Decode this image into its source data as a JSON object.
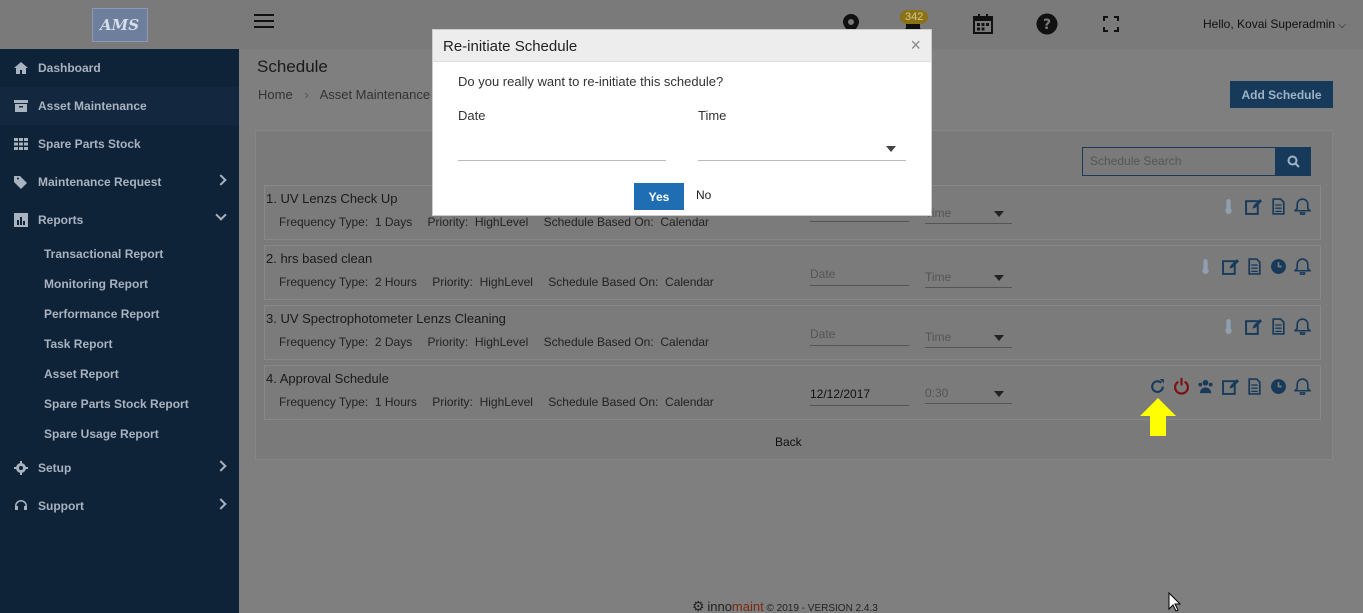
{
  "header": {
    "logo_text": "AMS",
    "notification_count": "342",
    "greeting": "Hello, Kovai Superadmin"
  },
  "sidebar": {
    "items": [
      {
        "label": "Dashboard",
        "icon": "home-icon"
      },
      {
        "label": "Asset Maintenance",
        "icon": "archive-icon"
      },
      {
        "label": "Spare Parts Stock",
        "icon": "grid-icon"
      },
      {
        "label": "Maintenance Request",
        "icon": "tag-icon"
      },
      {
        "label": "Reports",
        "icon": "bar-chart-icon"
      },
      {
        "label": "Setup",
        "icon": "gear-icon"
      },
      {
        "label": "Support",
        "icon": "headset-icon"
      }
    ],
    "report_subitems": [
      "Transactional Report",
      "Monitoring Report",
      "Performance Report",
      "Task Report",
      "Asset Report",
      "Spare Parts Stock Report",
      "Spare Usage Report"
    ]
  },
  "page": {
    "title": "Schedule",
    "breadcrumb": [
      "Home",
      "Asset Maintenance"
    ],
    "add_button": "Add Schedule",
    "search_placeholder": "Schedule Search",
    "back": "Back"
  },
  "schedules": [
    {
      "title": "1. UV Lenzs Check Up",
      "frequency_label": "Frequency Type:",
      "frequency": "1 Days",
      "priority_label": "Priority:",
      "priority": "HighLevel",
      "based_label": "Schedule Based On:",
      "based": "Calendar",
      "date": "",
      "time": "Time"
    },
    {
      "title": "2. hrs based clean",
      "frequency_label": "Frequency Type:",
      "frequency": "2 Hours",
      "priority_label": "Priority:",
      "priority": "HighLevel",
      "based_label": "Schedule Based On:",
      "based": "Calendar",
      "date": "Date",
      "time": "Time"
    },
    {
      "title": "3. UV Spectrophotometer Lenzs Cleaning",
      "frequency_label": "Frequency Type:",
      "frequency": "2 Days",
      "priority_label": "Priority:",
      "priority": "HighLevel",
      "based_label": "Schedule Based On:",
      "based": "Calendar",
      "date": "Date",
      "time": "Time"
    },
    {
      "title": "4. Approval Schedule",
      "frequency_label": "Frequency Type:",
      "frequency": "1 Hours",
      "priority_label": "Priority:",
      "priority": "HighLevel",
      "based_label": "Schedule Based On:",
      "based": "Calendar",
      "date": "12/12/2017",
      "time": "0:30"
    }
  ],
  "modal": {
    "title": "Re-initiate Schedule",
    "close": "×",
    "question": "Do you really want to re-initiate this schedule?",
    "date_label": "Date",
    "time_label": "Time",
    "yes": "Yes",
    "no": "No"
  },
  "footer": {
    "brand_prefix": "inno",
    "brand_suffix": "maint",
    "copyright": "© 2019 - VERSION 2.4.3"
  },
  "colors": {
    "sidebar_bg": "#0e2238",
    "primary_button": "#1f6db3",
    "overlay": "#7f7f7f",
    "highlight_arrow": "#ffff00"
  }
}
